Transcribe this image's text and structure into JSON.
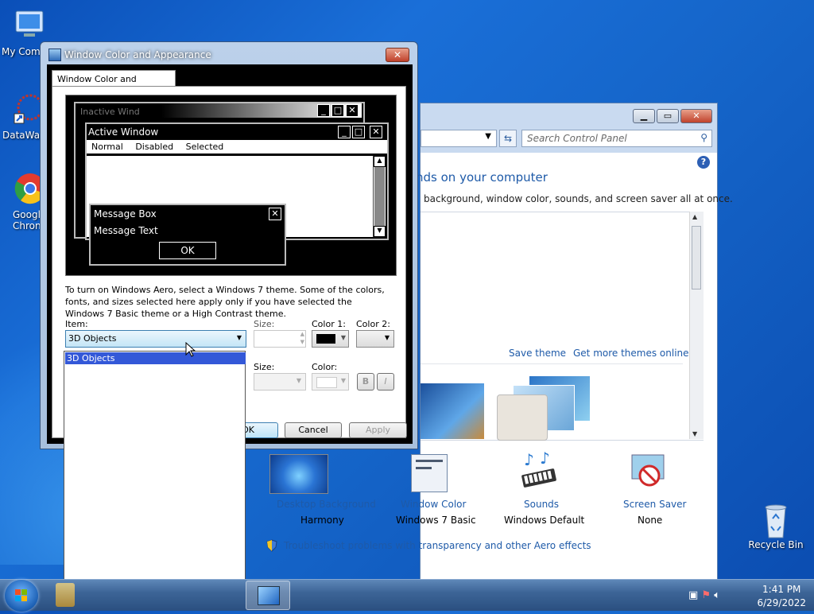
{
  "desktop": {
    "icons": [
      {
        "label": "My Comp"
      },
      {
        "label": "DataWag"
      },
      {
        "label": "Googl Chron"
      },
      {
        "label": "Recycle Bin"
      }
    ]
  },
  "control_panel": {
    "search_placeholder": "Search Control Panel",
    "heading": "nds on your computer",
    "subtitle": "background, window color, sounds, and screen saver all at once.",
    "save_theme": "Save theme",
    "more_themes": "Get more themes online",
    "items": [
      {
        "label": "Desktop Background",
        "value": "Harmony"
      },
      {
        "label": "Window Color",
        "value": "Windows 7 Basic"
      },
      {
        "label": "Sounds",
        "value": "Windows Default"
      },
      {
        "label": "Screen Saver",
        "value": "None"
      }
    ],
    "troubleshoot": "Troubleshoot problems with transparency and other Aero effects"
  },
  "dialog": {
    "title": "Window Color and Appearance",
    "tab": "Window Color and Appearance",
    "preview": {
      "inactive_title": "Inactive Wind",
      "active_title": "Active Window",
      "menu": [
        "Normal",
        "Disabled",
        "Selected"
      ],
      "msgbox_title": "Message Box",
      "msgbox_text": "Message Text",
      "ok": "OK"
    },
    "description": "To turn on Windows Aero, select a Windows 7 theme.  Some of the colors, fonts, and sizes selected here apply only if you have selected the Windows 7 Basic theme or a High Contrast theme.",
    "item_label": "Item:",
    "item_value": "3D Objects",
    "size_label": "Size:",
    "color1_label": "Color 1:",
    "color2_label": "Color 2:",
    "size2_label": "Size:",
    "color_label": "Color:",
    "bold": "B",
    "italic": "I",
    "ok": "OK",
    "cancel": "Cancel",
    "apply": "Apply",
    "dropdown_options": [
      "3D Objects"
    ]
  },
  "taskbar": {
    "time": "1:41 PM",
    "date": "6/29/2022"
  }
}
